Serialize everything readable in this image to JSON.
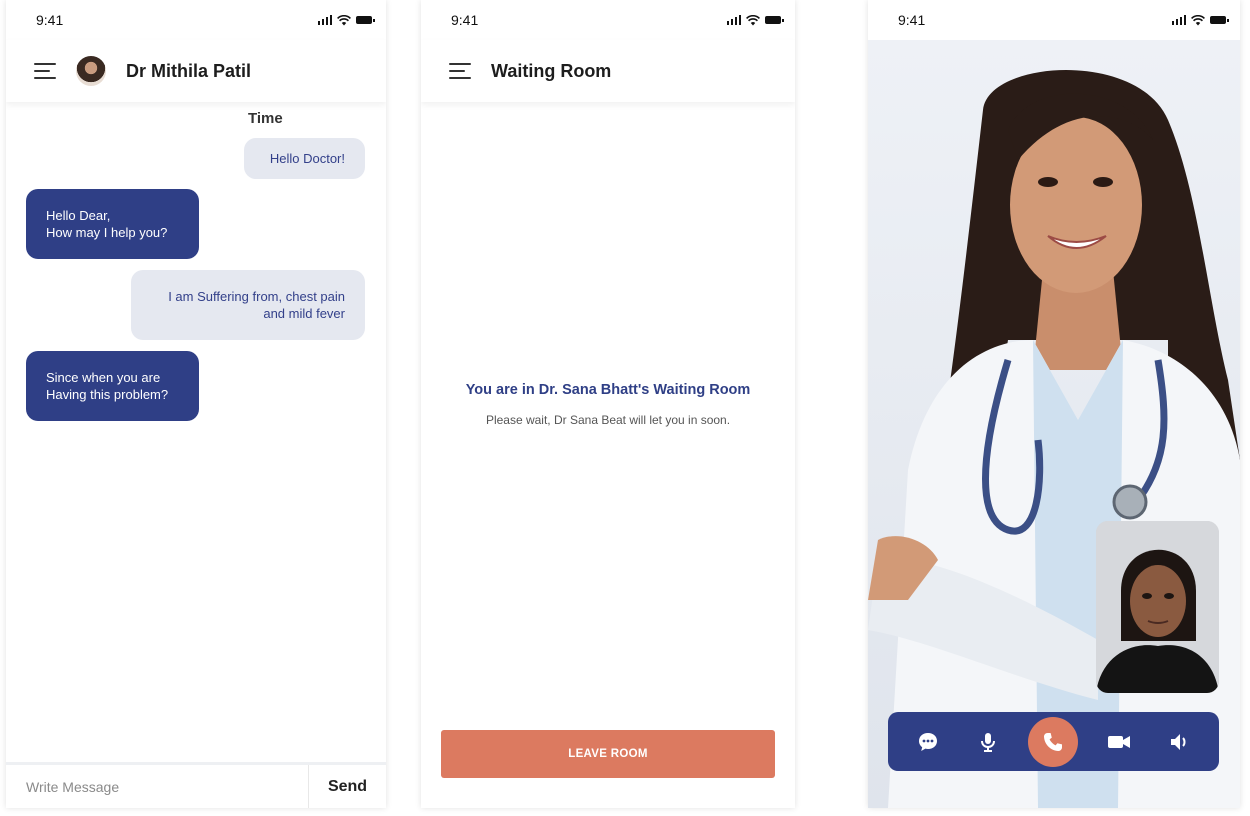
{
  "chat_screen": {
    "status_time": "9:41",
    "doctor_name": "Dr Mithila Patil",
    "time_label": "Time",
    "messages": [
      {
        "side": "out",
        "lines": [
          "Hello Doctor!"
        ]
      },
      {
        "side": "in",
        "lines": [
          "Hello Dear,",
          "How may I help you?"
        ]
      },
      {
        "side": "out",
        "lines": [
          "I am Suffering from, chest pain",
          "and mild fever"
        ]
      },
      {
        "side": "in",
        "lines": [
          "Since when you are",
          "Having this problem?"
        ]
      }
    ],
    "input_placeholder": "Write Message",
    "send_label": "Send"
  },
  "waiting_screen": {
    "status_time": "9:41",
    "title": "Waiting Room",
    "message_title": "You are in Dr. Sana Bhatt's Waiting Room",
    "message_sub": "Please wait, Dr Sana Beat will let you in soon.",
    "leave_label": "LEAVE ROOM"
  },
  "call_screen": {
    "status_time": "9:41",
    "controls": [
      "chat-icon",
      "microphone-icon",
      "end-call-icon",
      "video-camera-icon",
      "speaker-icon"
    ]
  },
  "colors": {
    "primary": "#2f3f86",
    "accent": "#dc7a60",
    "incoming_bubble": "#2f3f86",
    "outgoing_bubble": "#e5e8f0"
  }
}
